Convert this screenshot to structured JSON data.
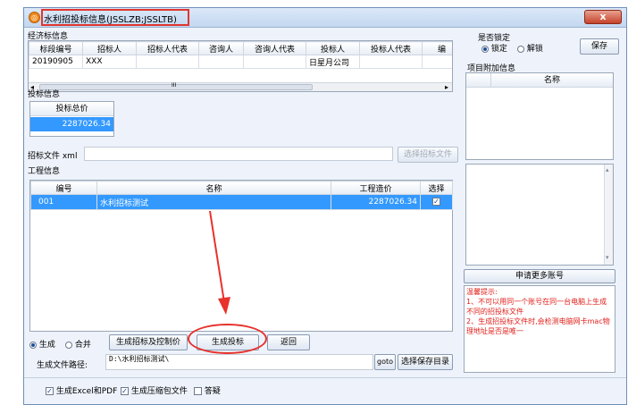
{
  "window": {
    "title": "水利招投标信息(JSSLZB;JSSLTB)",
    "close": "x"
  },
  "economic": {
    "section": "经济标信息",
    "columns": [
      "标段编号",
      "招标人",
      "招标人代表",
      "咨询人",
      "咨询人代表",
      "投标人",
      "投标人代表",
      "编"
    ],
    "row": [
      "20190905",
      "XXX",
      "",
      "",
      "",
      "日星月公司",
      "",
      ""
    ],
    "scroll_mark": "III"
  },
  "bid": {
    "section": "投标信息",
    "header": "投标总价",
    "value": "2287026.34"
  },
  "tender_file": {
    "label": "招标文件 xml",
    "button": "选择招标文件"
  },
  "project": {
    "section": "工程信息",
    "columns": [
      "编号",
      "名称",
      "工程造价",
      "选择"
    ],
    "row": {
      "code": "001",
      "name": "水利招标测试",
      "cost": "2287026.34",
      "checked": "✓"
    }
  },
  "mode": {
    "generate": "生成",
    "merge": "合并"
  },
  "actions": {
    "gen_control": "生成招标及控制价",
    "gen_bid": "生成投标",
    "back": "返回"
  },
  "output": {
    "label": "生成文件路径:",
    "path": "D:\\水利招标测试\\",
    "goto": "goto",
    "choose": "选择保存目录"
  },
  "lock": {
    "label": "是否锁定",
    "locked": "锁定",
    "unlocked": "解锁",
    "save": "保存"
  },
  "extra": {
    "section": "项目附加信息",
    "column": "名称"
  },
  "apply_button": "申请更多账号",
  "notice": {
    "title": "温馨提示:",
    "line1": "1、不可以用同一个账号在同一台电脑上生成不同的招投标文件",
    "line2": "2、生成招投标文件时,会检测电脑网卡mac物理地址是否是唯一"
  },
  "footer": {
    "excel_pdf": "生成Excel和PDF",
    "zip": "生成压缩包文件",
    "query": "答疑"
  },
  "colors": {
    "highlight_red": "#e0362f",
    "selection_blue": "#3399ff"
  }
}
